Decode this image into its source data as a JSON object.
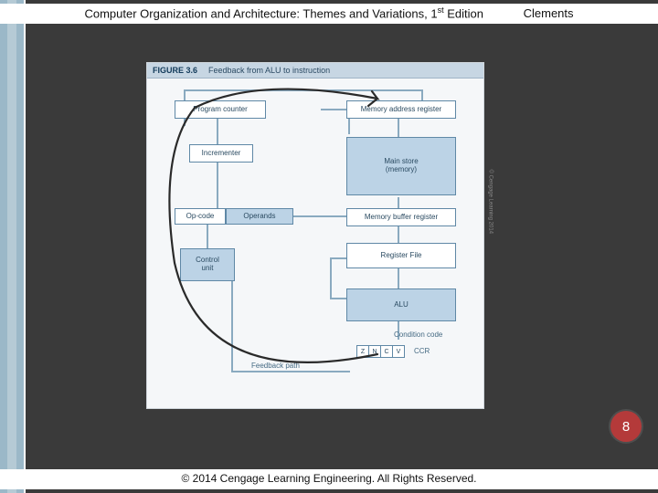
{
  "header": {
    "title_prefix": "Computer Organization and Architecture: Themes and Variations, 1",
    "title_sup": "st",
    "title_suffix": " Edition",
    "author": "Clements"
  },
  "figure": {
    "number": "FIGURE 3.6",
    "caption": "Feedback from ALU to instruction"
  },
  "boxes": {
    "program_counter": "Program counter",
    "memory_address_register": "Memory address register",
    "incrementer": "Incrementer",
    "main_store": "Main store\n(memory)",
    "op_code": "Op-code",
    "operands": "Operands",
    "memory_buffer_register": "Memory buffer register",
    "control_unit": "Control\nunit",
    "register_file": "Register File",
    "alu": "ALU",
    "condition_code": "Condition code"
  },
  "labels": {
    "feedback_path": "Feedback path",
    "ccr": "CCR"
  },
  "ccr_flags": [
    "Z",
    "N",
    "C",
    "V"
  ],
  "side_copyright": "© Cengage Learning 2014",
  "page_number": "8",
  "footer": "© 2014 Cengage Learning Engineering. All Rights Reserved."
}
